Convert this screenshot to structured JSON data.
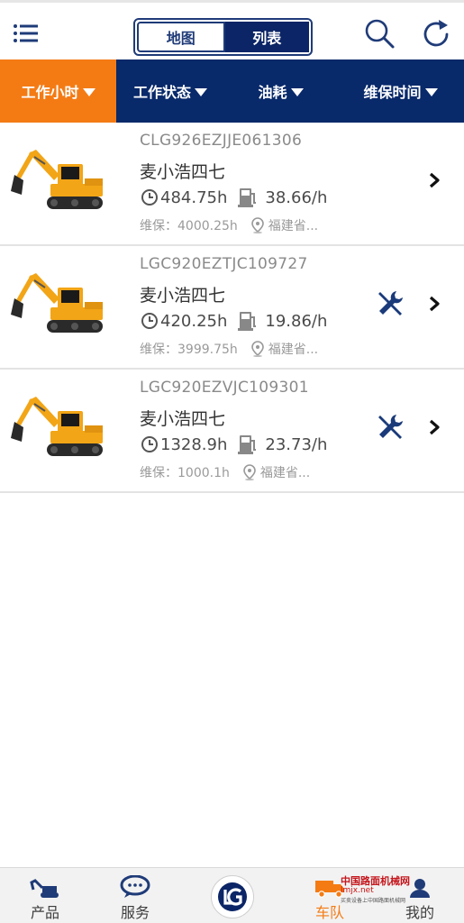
{
  "header": {
    "segments": [
      "地图",
      "列表"
    ],
    "active_segment": "列表"
  },
  "filters": [
    {
      "label": "工作小时",
      "active": true
    },
    {
      "label": "工作状态",
      "active": false
    },
    {
      "label": "油耗",
      "active": false
    },
    {
      "label": "维保时间",
      "active": false
    }
  ],
  "machines": [
    {
      "serial": "CLG926EZJJE061306",
      "name": "麦小浩四七",
      "hours": "484.75h",
      "fuel": "38.66/h",
      "maintenance": "维保：4000.25h",
      "location": "福建省...",
      "has_alert": false
    },
    {
      "serial": "LGC920EZTJC109727",
      "name": "麦小浩四七",
      "hours": "420.25h",
      "fuel": "19.86/h",
      "maintenance": "维保：3999.75h",
      "location": "福建省...",
      "has_alert": true
    },
    {
      "serial": "LGC920EZVJC109301",
      "name": "麦小浩四七",
      "hours": "1328.9h",
      "fuel": "23.73/h",
      "maintenance": "维保：1000.1h",
      "location": "福建省...",
      "has_alert": true
    }
  ],
  "tabbar": {
    "product": "产品",
    "service": "服务",
    "fleet": "车队",
    "mine": "我的"
  },
  "watermark": {
    "main": "中国路面机械网",
    "site": "lmjx.net",
    "sub": "买卖设备上中国路面机械网"
  },
  "colors": {
    "accent_orange": "#f47b14",
    "brand_navy": "#08296a"
  }
}
